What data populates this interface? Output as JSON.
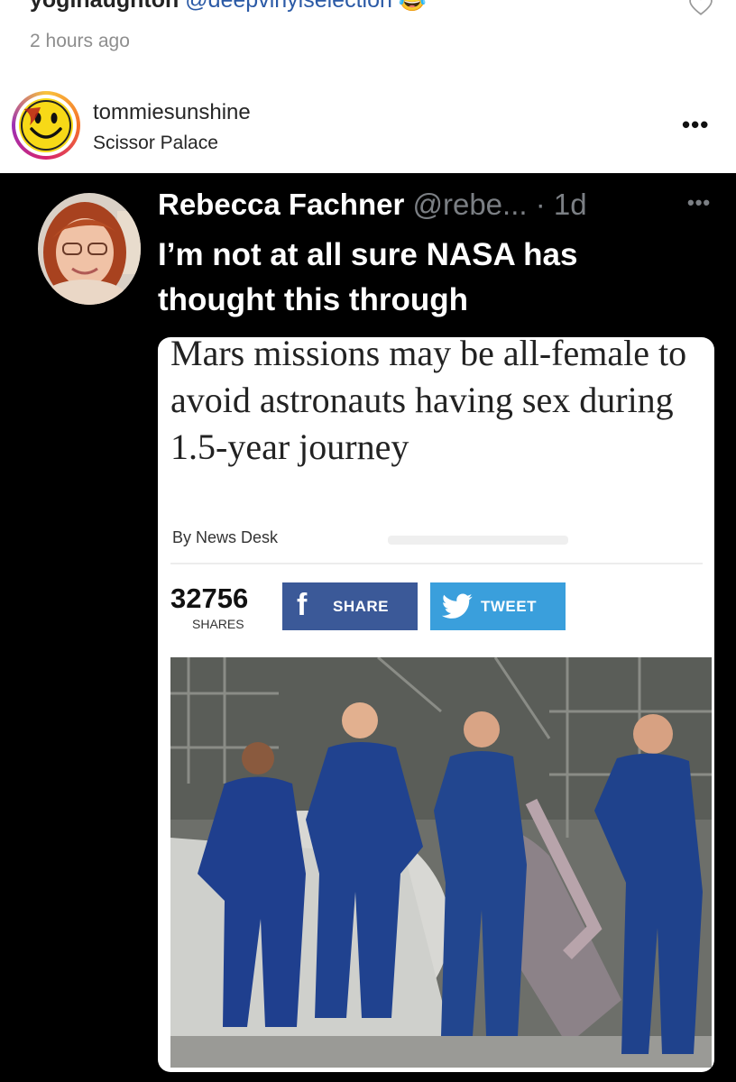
{
  "previous_comment": {
    "username": "yoginaughton",
    "mention": "@deepvinylselection",
    "emoji": "😂",
    "time": "2 hours ago"
  },
  "post": {
    "username": "tommiesunshine",
    "location": "Scissor Palace",
    "more_icon": "more-horizontal-icon"
  },
  "tweet": {
    "name": "Rebecca Fachner",
    "handle": "@rebe... · 1d",
    "text": "I’m not at all sure NASA has thought this through",
    "article": {
      "headline": "Mars missions may be all-female to avoid astronauts having sex during 1.5-year journey",
      "byline": "By News Desk",
      "shares_count": "32756",
      "shares_label": "SHARES",
      "share_button": "SHARE",
      "tweet_button": "TWEET",
      "colors": {
        "facebook": "#3b5998",
        "twitter": "#3a9fdc"
      }
    }
  }
}
